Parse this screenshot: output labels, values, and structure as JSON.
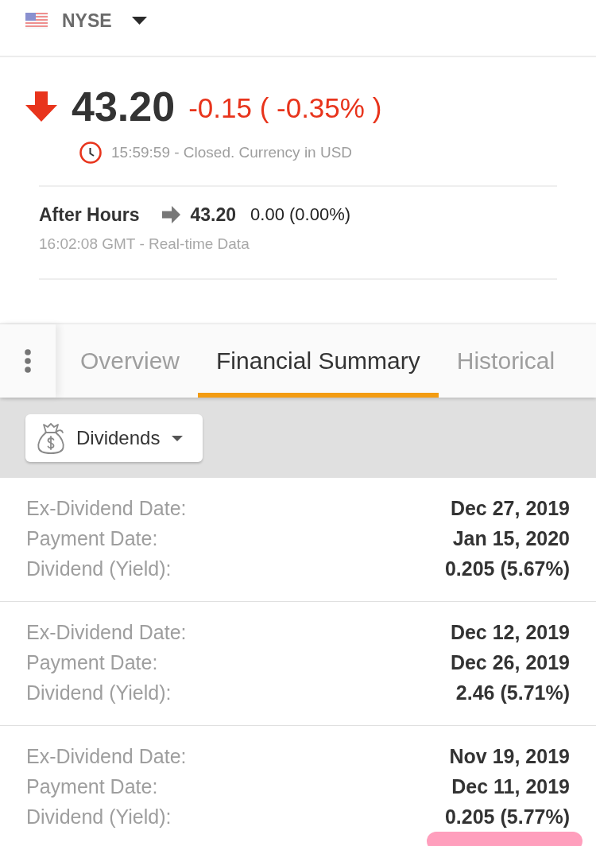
{
  "exchange": {
    "name": "NYSE"
  },
  "quote": {
    "kind": "down",
    "price": "43.20",
    "change": "-0.15 ( -0.35% )",
    "status": "15:59:59 - Closed. Currency in USD"
  },
  "after_hours": {
    "label": "After Hours",
    "kind": "flat",
    "price": "43.20",
    "change": "0.00 (0.00%)",
    "timestamp": "16:02:08 GMT - Real-time Data"
  },
  "tabs": [
    {
      "label": "Overview",
      "selected": false
    },
    {
      "label": "Financial Summary",
      "selected": true
    },
    {
      "label": "Historical",
      "selected": false
    }
  ],
  "filter": {
    "label": "Dividends"
  },
  "dividends": [
    {
      "rows": [
        {
          "label": "Ex-Dividend Date:",
          "value": "Dec 27, 2019"
        },
        {
          "label": "Payment Date:",
          "value": "Jan 15, 2020"
        },
        {
          "label": "Dividend (Yield):",
          "value": "0.205 (5.67%)"
        }
      ]
    },
    {
      "rows": [
        {
          "label": "Ex-Dividend Date:",
          "value": "Dec 12, 2019"
        },
        {
          "label": "Payment Date:",
          "value": "Dec 26, 2019"
        },
        {
          "label": "Dividend (Yield):",
          "value": "2.46 (5.71%)"
        }
      ]
    },
    {
      "rows": [
        {
          "label": "Ex-Dividend Date:",
          "value": "Nov 19, 2019"
        },
        {
          "label": "Payment Date:",
          "value": "Dec 11, 2019"
        },
        {
          "label": "Dividend (Yield):",
          "value": "0.205 (5.77%)"
        }
      ]
    }
  ]
}
